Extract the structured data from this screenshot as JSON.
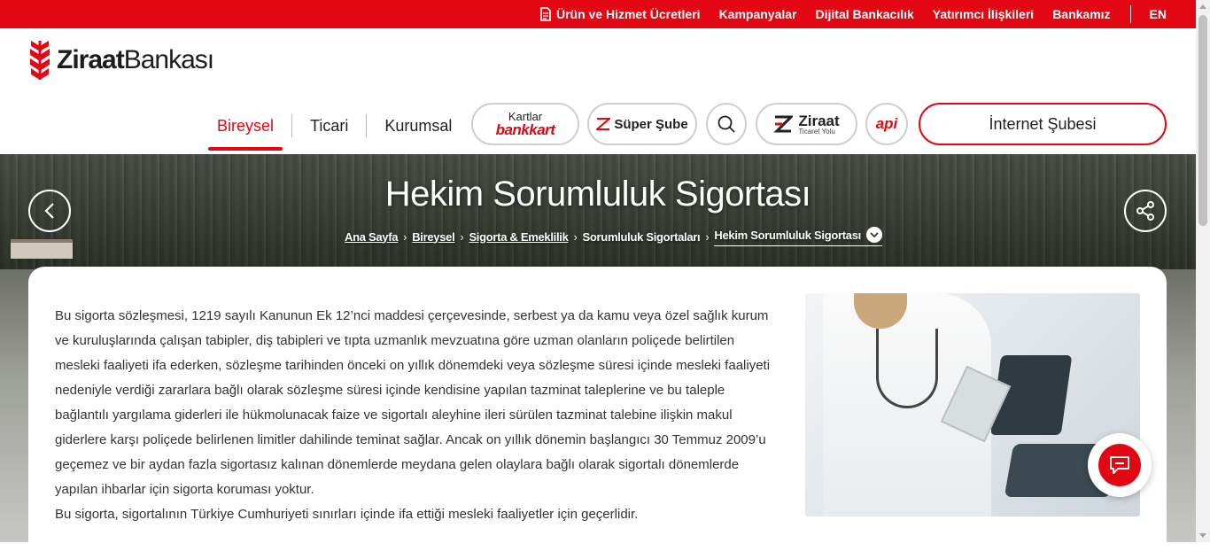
{
  "topbar": {
    "links": [
      {
        "label": "Ürün ve Hizmet Ücretleri",
        "icon": "document-icon"
      },
      {
        "label": "Kampanyalar"
      },
      {
        "label": "Dijital Bankacılık"
      },
      {
        "label": "Yatırımcı İlişkileri"
      },
      {
        "label": "Bankamız"
      }
    ],
    "lang": "EN"
  },
  "logo": {
    "bold": "Ziraat",
    "light": "Bankası",
    "icon": "wheat-logo-icon"
  },
  "nav": {
    "tabs": [
      {
        "label": "Bireysel",
        "active": true
      },
      {
        "label": "Ticari",
        "active": false
      },
      {
        "label": "Kurumsal",
        "active": false
      }
    ],
    "kartlar_top": "Kartlar",
    "kartlar_brand": "bankkart",
    "super_sube": "Süper Şube",
    "ticaret_title": "Ziraat",
    "ticaret_sub": "Ticaret Yolu",
    "api_label": "api",
    "internet_subesi": "İnternet Şubesi"
  },
  "hero": {
    "title": "Hekim Sorumluluk Sigortası",
    "breadcrumb": [
      {
        "label": "Ana Sayfa",
        "link": true
      },
      {
        "label": "Bireysel",
        "link": true
      },
      {
        "label": "Sigorta & Emeklilik",
        "link": true
      },
      {
        "label": "Sorumluluk Sigortaları",
        "link": false
      }
    ],
    "current": "Hekim Sorumluluk Sigortası"
  },
  "content": {
    "paragraph1": "Bu sigorta sözleşmesi, 1219 sayılı Kanunun Ek 12’nci maddesi çerçevesinde, serbest ya da kamu veya özel sağlık kurum ve kuruluşlarında çalışan tabipler, diş tabipleri ve tıpta uzmanlık mevzuatına göre uzman olanların poliçede belirtilen mesleki faaliyeti ifa ederken, sözleşme tarihinden önceki on yıllık dönemdeki veya sözleşme süresi içinde mesleki faaliyeti nedeniyle verdiği zararlara bağlı olarak sözleşme süresi içinde kendisine yapılan tazminat taleplerine ve bu taleple bağlantılı yargılama giderleri ile hükmolunacak faize ve sigortalı aleyhine ileri sürülen tazminat talebine ilişkin makul giderlere karşı poliçede belirlenen limitler dahilinde teminat sağlar. Ancak on yıllık dönemin başlangıcı 30 Temmuz 2009’u geçemez ve bir aydan fazla sigortasız kalınan dönemlerde meydana gelen olaylara bağlı olarak sigortalı dönemlerde yapılan ihbarlar için sigorta koruması yoktur.",
    "paragraph2": "Bu sigorta, sigortalının Türkiye Cumhuriyeti sınırları içinde ifa ettiği mesleki faaliyetler için geçerlidir."
  },
  "colors": {
    "brand_red": "#e30613"
  }
}
